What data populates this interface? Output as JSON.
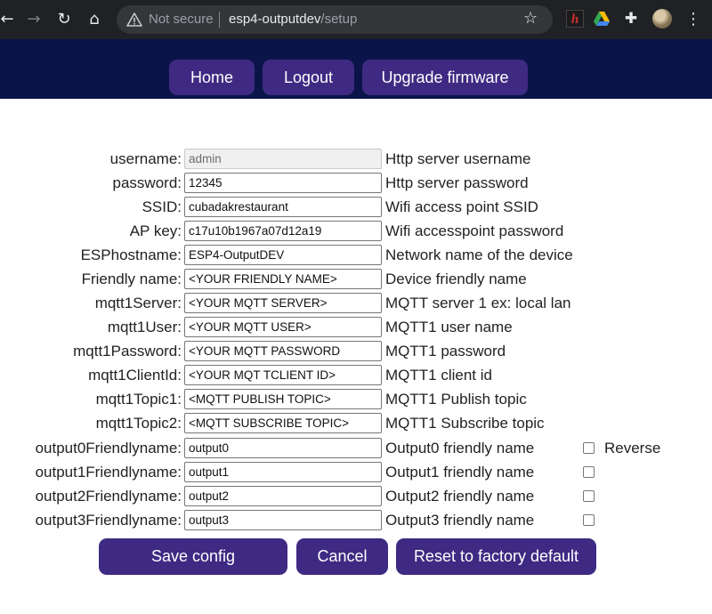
{
  "browser": {
    "not_secure_label": "Not secure",
    "url_host": "esp4-outputdev",
    "url_path": "/setup",
    "icons": [
      "back-icon",
      "forward-icon",
      "reload-icon",
      "home-icon",
      "warning-icon",
      "star-icon",
      "extension-h-icon",
      "drive-icon",
      "puzzle-icon",
      "avatar",
      "kebab-menu-icon"
    ]
  },
  "header": {
    "buttons": [
      {
        "label": "Home"
      },
      {
        "label": "Logout"
      },
      {
        "label": "Upgrade firmware"
      }
    ],
    "bg_color": "#0b1449",
    "button_color": "#3e2a82"
  },
  "form": {
    "fields": [
      {
        "label": "username:",
        "value": "admin",
        "description": "Http server username",
        "readonly": true
      },
      {
        "label": "password:",
        "value": "12345",
        "description": "Http server password"
      },
      {
        "label": "SSID:",
        "value": "cubadakrestaurant",
        "description": "Wifi access point SSID"
      },
      {
        "label": "AP key:",
        "value": "c17u10b1967a07d12a19",
        "description": "Wifi accesspoint password"
      },
      {
        "label": "ESPhostname:",
        "value": "ESP4-OutputDEV",
        "description": "Network name of the device"
      },
      {
        "label": "Friendly name:",
        "value": "<YOUR FRIENDLY NAME>",
        "description": "Device friendly name"
      },
      {
        "label": "mqtt1Server:",
        "value": "<YOUR MQTT SERVER>",
        "description": "MQTT server 1 ex: local lan"
      },
      {
        "label": "mqtt1User:",
        "value": "<YOUR MQTT USER>",
        "description": "MQTT1 user name"
      },
      {
        "label": "mqtt1Password:",
        "value": "<YOUR MQTT PASSWORD",
        "description": "MQTT1 password"
      },
      {
        "label": "mqtt1ClientId:",
        "value": "<YOUR MQT TCLIENT ID>",
        "description": "MQTT1 client id"
      },
      {
        "label": "mqtt1Topic1:",
        "value": "<MQTT PUBLISH TOPIC>",
        "description": "MQTT1 Publish topic"
      },
      {
        "label": "mqtt1Topic2:",
        "value": "<MQTT SUBSCRIBE TOPIC>",
        "description": "MQTT1 Subscribe topic"
      },
      {
        "label": "output0Friendlyname:",
        "value": "output0",
        "description": "Output0 friendly name",
        "reverse_checked": false
      },
      {
        "label": "output1Friendlyname:",
        "value": "output1",
        "description": "Output1 friendly name",
        "reverse_checked": false
      },
      {
        "label": "output2Friendlyname:",
        "value": "output2",
        "description": "Output2 friendly name",
        "reverse_checked": false
      },
      {
        "label": "output3Friendlyname:",
        "value": "output3",
        "description": "Output3 friendly name",
        "reverse_checked": false
      }
    ],
    "reverse_label": "Reverse"
  },
  "actions": {
    "save_label": "Save config",
    "cancel_label": "Cancel",
    "reset_label": "Reset to factory default"
  }
}
